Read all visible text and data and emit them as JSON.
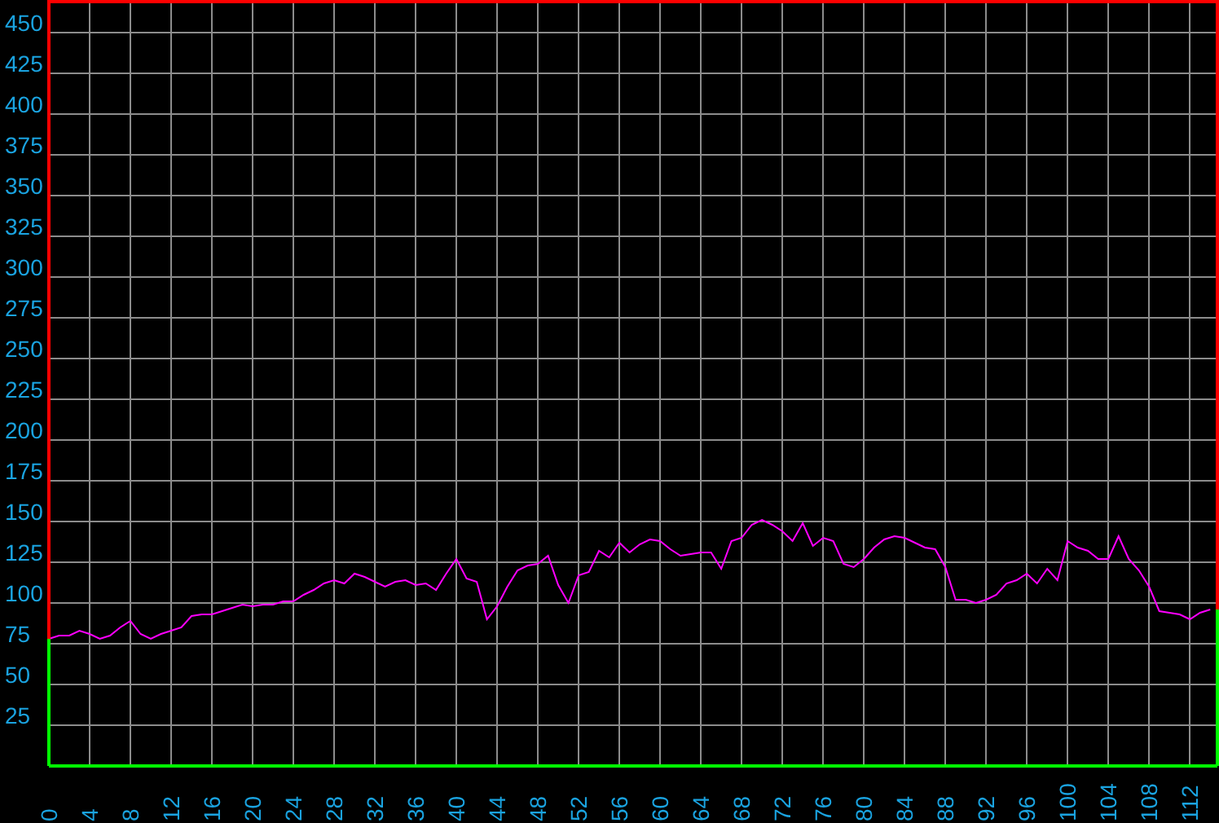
{
  "chart": {
    "chart_data": {
      "type": "line",
      "x": [
        0,
        1,
        2,
        3,
        4,
        5,
        6,
        7,
        8,
        9,
        10,
        11,
        12,
        13,
        14,
        15,
        16,
        17,
        18,
        19,
        20,
        21,
        22,
        23,
        24,
        25,
        26,
        27,
        28,
        29,
        30,
        31,
        32,
        33,
        34,
        35,
        36,
        37,
        38,
        39,
        40,
        41,
        42,
        43,
        44,
        45,
        46,
        47,
        48,
        49,
        50,
        51,
        52,
        53,
        54,
        55,
        56,
        57,
        58,
        59,
        60,
        61,
        62,
        63,
        64,
        65,
        66,
        67,
        68,
        69,
        70,
        71,
        72,
        73,
        74,
        75,
        76,
        77,
        78,
        79,
        80,
        81,
        82,
        83,
        84,
        85,
        86,
        87,
        88,
        89,
        90,
        91,
        92,
        93,
        94,
        95,
        96,
        97,
        98,
        99,
        100,
        101,
        102,
        103,
        104,
        105,
        106,
        107,
        108,
        109,
        110,
        111,
        112,
        113,
        114
      ],
      "grid": true,
      "series": [
        {
          "color": "#ff00ff",
          "values": [
            78,
            80,
            80,
            83,
            81,
            78,
            80,
            85,
            89,
            81,
            78,
            81,
            83,
            85,
            92,
            93,
            93,
            95,
            97,
            99,
            98,
            99,
            99,
            101,
            101,
            105,
            108,
            112,
            114,
            112,
            118,
            116,
            113,
            110,
            113,
            114,
            111,
            112,
            108,
            118,
            127,
            115,
            113,
            90,
            98,
            110,
            120,
            123,
            124,
            129,
            111,
            100,
            117,
            119,
            132,
            128,
            137,
            131,
            136,
            139,
            138,
            133,
            129,
            130,
            131,
            131,
            121,
            138,
            140,
            148,
            151,
            148,
            144,
            138,
            149,
            135,
            140,
            138,
            124,
            122,
            127,
            134,
            139,
            141,
            140,
            137,
            134,
            133,
            122,
            102,
            102,
            100,
            102,
            105,
            112,
            114,
            118,
            112,
            121,
            114,
            138,
            134,
            132,
            127,
            127,
            141,
            127,
            120,
            110,
            95,
            94,
            93,
            90,
            94,
            96
          ]
        }
      ],
      "xlim": [
        0,
        114.7
      ],
      "ylim": [
        0,
        470
      ],
      "xticks": [
        0,
        4,
        8,
        12,
        16,
        20,
        24,
        28,
        32,
        36,
        40,
        44,
        48,
        52,
        56,
        60,
        64,
        68,
        72,
        76,
        80,
        84,
        88,
        92,
        96,
        100,
        104,
        108,
        112
      ],
      "yticks": [
        25,
        50,
        75,
        100,
        125,
        150,
        175,
        200,
        225,
        250,
        275,
        300,
        325,
        350,
        375,
        400,
        425,
        450
      ]
    }
  }
}
